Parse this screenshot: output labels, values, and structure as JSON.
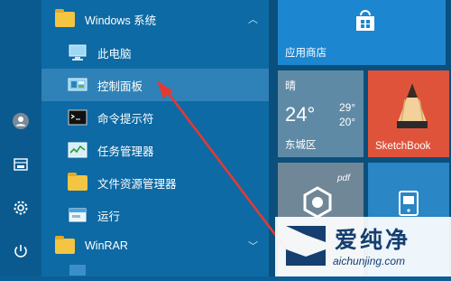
{
  "colors": {
    "accent": "#0d6aa4",
    "selected": "#2f82b8",
    "store_tile": "#1d86d0",
    "sketch_tile": "#e0533b",
    "weather_tile": "#5f8aa6"
  },
  "start_list": [
    {
      "kind": "group",
      "label": "Windows 系统",
      "icon": "folder-icon",
      "expanded": true
    },
    {
      "kind": "item",
      "label": "此电脑",
      "icon": "this-pc-icon"
    },
    {
      "kind": "item",
      "label": "控制面板",
      "icon": "control-panel-icon",
      "selected": true
    },
    {
      "kind": "item",
      "label": "命令提示符",
      "icon": "command-prompt-icon"
    },
    {
      "kind": "item",
      "label": "任务管理器",
      "icon": "task-manager-icon"
    },
    {
      "kind": "item",
      "label": "文件资源管理器",
      "icon": "file-explorer-icon"
    },
    {
      "kind": "item",
      "label": "运行",
      "icon": "run-icon"
    },
    {
      "kind": "group",
      "label": "WinRAR",
      "icon": "folder-icon",
      "expanded": false
    }
  ],
  "rail_icons": [
    "user-icon",
    "documents-icon",
    "settings-icon",
    "power-icon"
  ],
  "tiles": {
    "store": {
      "label": "应用商店",
      "icon": "store-icon"
    },
    "weather": {
      "condition": "晴",
      "temp": "24°",
      "high": "29°",
      "low": "20°",
      "city": "东城区"
    },
    "sketch": {
      "label": "SketchBook",
      "icon": "pencil-icon"
    },
    "pdf_tag": "pdf"
  },
  "watermark": {
    "text": "爱纯净",
    "url": "aichunjing.com"
  }
}
